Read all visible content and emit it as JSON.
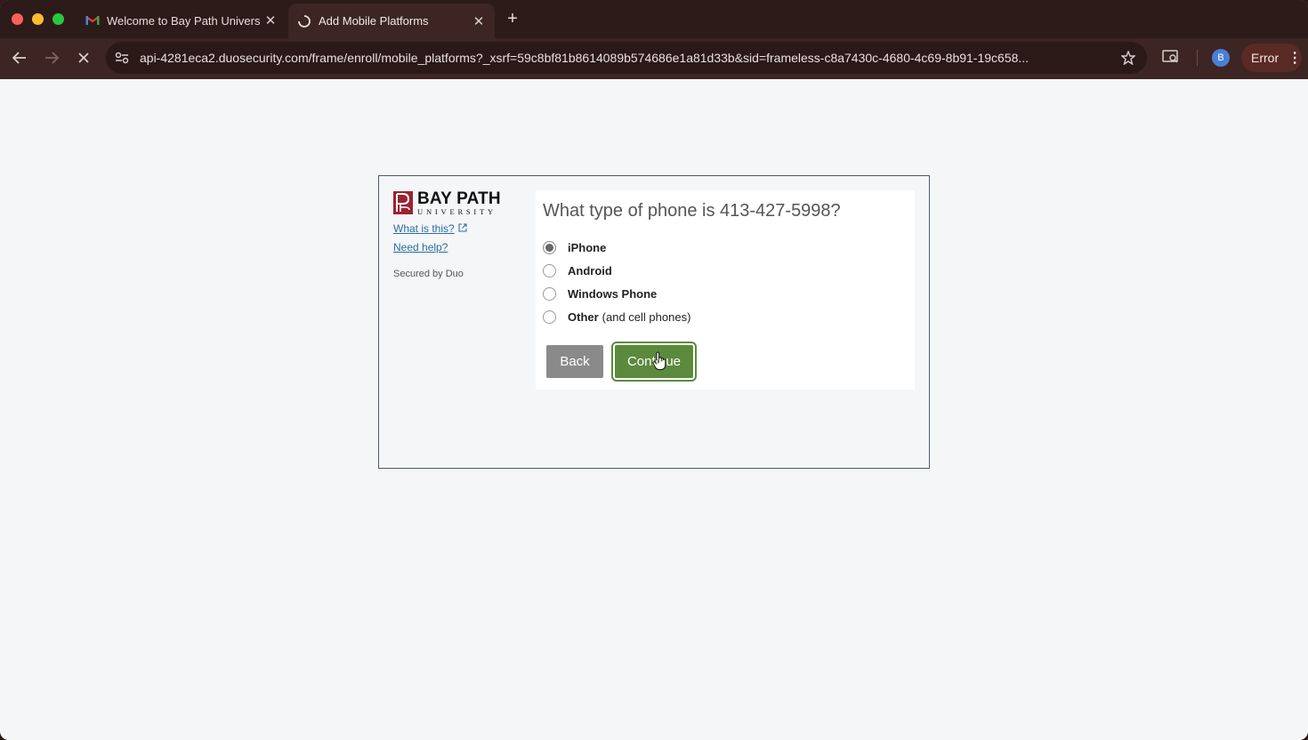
{
  "browser": {
    "tabs": [
      {
        "title": "Welcome to Bay Path Univers",
        "favicon": "gmail-icon",
        "active": false
      },
      {
        "title": "Add Mobile Platforms",
        "favicon": "loading-spinner-icon",
        "active": true
      }
    ],
    "new_tab_label": "+",
    "url": "api-4281eca2.duosecurity.com/frame/enroll/mobile_platforms?_xsrf=59c8bf81b8614089b574686e1a81d33b&sid=frameless-c8a7430c-4680-4c69-8b91-19c658...",
    "profile_initial": "B",
    "error_label": "Error"
  },
  "duo": {
    "logo_main": "BAY PATH",
    "logo_sub": "UNIVERSITY",
    "what_is_this": "What is this?",
    "need_help": "Need help?",
    "secured_by": "Secured by Duo",
    "question": "What type of phone is 413-427-5998?",
    "options": [
      {
        "label": "iPhone",
        "sub": "",
        "checked": true
      },
      {
        "label": "Android",
        "sub": "",
        "checked": false
      },
      {
        "label": "Windows Phone",
        "sub": "",
        "checked": false
      },
      {
        "label": "Other",
        "sub": "(and cell phones)",
        "checked": false
      }
    ],
    "back_label": "Back",
    "continue_label": "Continue"
  },
  "colors": {
    "accent_green": "#5b8a3c",
    "link_blue": "#2b6da3",
    "brand_red": "#9b2331"
  }
}
